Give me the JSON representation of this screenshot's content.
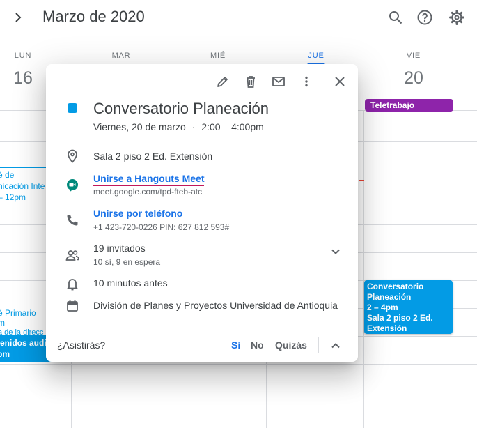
{
  "header": {
    "title": "Marzo de 2020"
  },
  "days": [
    {
      "name": "LUN",
      "num": "16"
    },
    {
      "name": "MAR",
      "num": ""
    },
    {
      "name": "MIÉ",
      "num": ""
    },
    {
      "name": "JUE",
      "num": ""
    },
    {
      "name": "VIE",
      "num": "20"
    }
  ],
  "left_events": {
    "e1_line1": "é de",
    "e1_line2": "nicación Inte",
    "e1_line3": "– 12pm",
    "e2_line1": "é Primario",
    "e2_line2": "m",
    "e2_line3": "a de la direcc",
    "e2_line4": "tenidos audie",
    "e2_line5": "pm"
  },
  "friday_events": {
    "teletrabajo": "Teletrabajo",
    "conv_title": "Conversatorio Planeación",
    "conv_time": "2 – 4pm",
    "conv_place": "Sala 2 piso 2 Ed. Extensión"
  },
  "popover": {
    "title": "Conversatorio Planeación",
    "date": "Viernes, 20 de marzo",
    "time_sep": "·",
    "time": "2:00 – 4:00pm",
    "location": "Sala 2 piso 2 Ed. Extensión",
    "meet_link": "Unirse a Hangouts Meet",
    "meet_url": "meet.google.com/tpd-fteb-atc",
    "phone_link": "Unirse por teléfono",
    "phone_detail": "+1 423-720-0226 PIN: 627 812 593#",
    "guests": "19 invitados",
    "guests_detail": "10 sí, 9 en espera",
    "reminder": "10 minutos antes",
    "organizer": "División de Planes y Proyectos Universidad de Antioquia",
    "rsvp_question": "¿Asistirás?",
    "rsvp_yes": "Sí",
    "rsvp_no": "No",
    "rsvp_maybe": "Quizás"
  },
  "colors": {
    "event_blue": "#039be5",
    "teletrabajo": "#8e24aa",
    "accent": "#1a73e8",
    "meet_green": "#00897b",
    "current_time_line": "#ea4335"
  }
}
